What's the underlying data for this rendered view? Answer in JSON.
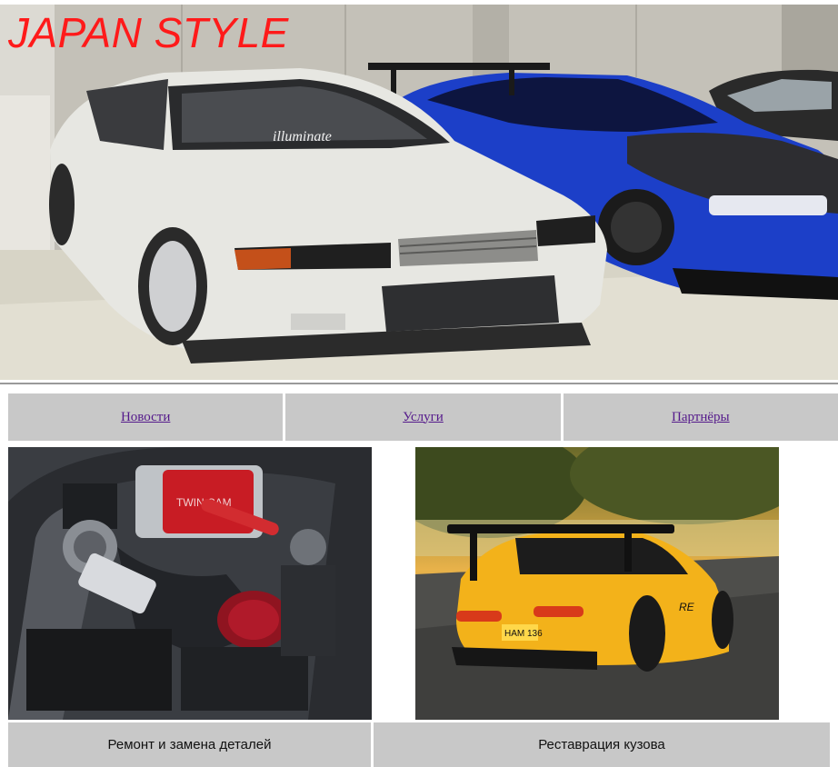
{
  "header": {
    "title": "JAPAN STYLE",
    "title_color": "#ff1a1a",
    "banner_image": "white-and-blue-nissan-skyline-cars-photo"
  },
  "nav": {
    "items": [
      {
        "label": "Новости"
      },
      {
        "label": "Услуги"
      },
      {
        "label": "Партнёры"
      }
    ],
    "link_color": "#551a8b",
    "cell_color": "#c8c8c8"
  },
  "services": [
    {
      "image": "engine-bay-photo",
      "caption": "Ремонт и замена деталей"
    },
    {
      "image": "yellow-mazda-rx7-photo",
      "caption": "Реставрация кузова"
    }
  ]
}
